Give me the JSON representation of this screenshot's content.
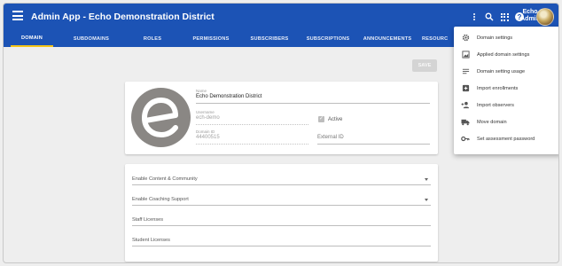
{
  "app": {
    "title": "Admin App - Echo Demonstration District",
    "user_name_line1": "Echo",
    "user_name_line2": "Admin",
    "help_glyph": "?",
    "colors": {
      "primary": "#1c53b5",
      "tab_indicator": "#f5c518"
    }
  },
  "tabs": [
    {
      "label": "DOMAIN",
      "active": true
    },
    {
      "label": "SUBDOMAINS"
    },
    {
      "label": "ROLES"
    },
    {
      "label": "PERMISSIONS"
    },
    {
      "label": "SUBSCRIBERS"
    },
    {
      "label": "SUBSCRIPTIONS"
    },
    {
      "label": "ANNOUNCEMENTS"
    },
    {
      "label": "RESOURC"
    }
  ],
  "save_label": "SAVE",
  "domain": {
    "name_label": "Name",
    "name_value": "Echo Demonstration District",
    "username_label": "Username",
    "username_value": "ech-demo",
    "active_label": "Active",
    "active_checked": true,
    "domain_id_label": "Domain ID",
    "domain_id_value": "44400515",
    "external_id_placeholder": "External ID"
  },
  "settings": {
    "content_label": "Enable Content & Community",
    "coaching_label": "Enable Coaching Support",
    "staff_placeholder": "Staff Licenses",
    "student_placeholder": "Student Licenses"
  },
  "menu": [
    {
      "label": "Domain settings",
      "icon": "gear-icon"
    },
    {
      "label": "Applied domain settings",
      "icon": "image-settings-icon"
    },
    {
      "label": "Domain setting usage",
      "icon": "list-icon"
    },
    {
      "label": "Import enrollments",
      "icon": "add-box-icon"
    },
    {
      "label": "Import observers",
      "icon": "person-add-icon"
    },
    {
      "label": "Move domain",
      "icon": "truck-icon"
    },
    {
      "label": "Set assessment password",
      "icon": "key-icon"
    }
  ]
}
